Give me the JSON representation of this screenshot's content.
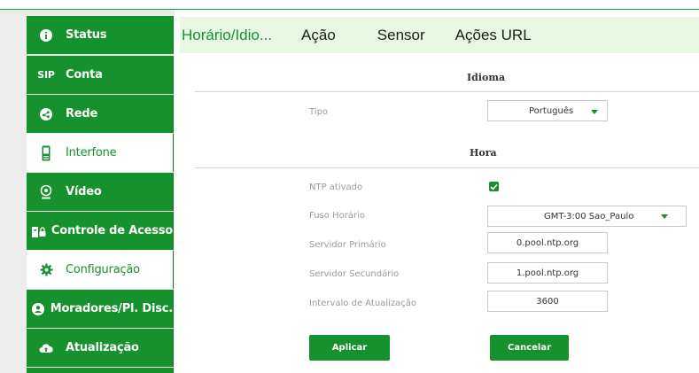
{
  "sidebar": {
    "items": [
      {
        "label": "Status",
        "icon": "info-icon"
      },
      {
        "label": "Conta",
        "icon": "sip-icon",
        "icon_text": "SIP"
      },
      {
        "label": "Rede",
        "icon": "network-icon"
      },
      {
        "label": "Interfone",
        "icon": "intercom-icon"
      },
      {
        "label": "Vídeo",
        "icon": "webcam-icon"
      },
      {
        "label": "Controle de Acesso",
        "icon": "access-control-icon"
      },
      {
        "label": "Configuração",
        "icon": "gear-icon"
      },
      {
        "label": "Moradores/Pl. Disc.",
        "icon": "user-icon"
      },
      {
        "label": "Atualização",
        "icon": "cloud-upload-icon"
      }
    ]
  },
  "tabs": [
    "Horário/Idio...",
    "Ação",
    "Sensor",
    "Ações URL"
  ],
  "idioma": {
    "section_title": "Idioma",
    "tipo_label": "Tipo",
    "tipo_value": "Português"
  },
  "hora": {
    "section_title": "Hora",
    "ntp_label": "NTP ativado",
    "fuso_label": "Fuso Horário",
    "fuso_value": "GMT-3:00 Sao_Paulo",
    "primario_label": "Servidor Primário",
    "primario_value": "0.pool.ntp.org",
    "secundario_label": "Servidor Secundário",
    "secundario_value": "1.pool.ntp.org",
    "intervalo_label": "Intervalo de Atualização",
    "intervalo_value": "3600"
  },
  "buttons": {
    "apply": "Aplicar",
    "cancel": "Cancelar"
  },
  "colors": {
    "accent": "#15922d",
    "tab_bar": "#e9f8e5",
    "sidebar_bg": "#ececec"
  }
}
